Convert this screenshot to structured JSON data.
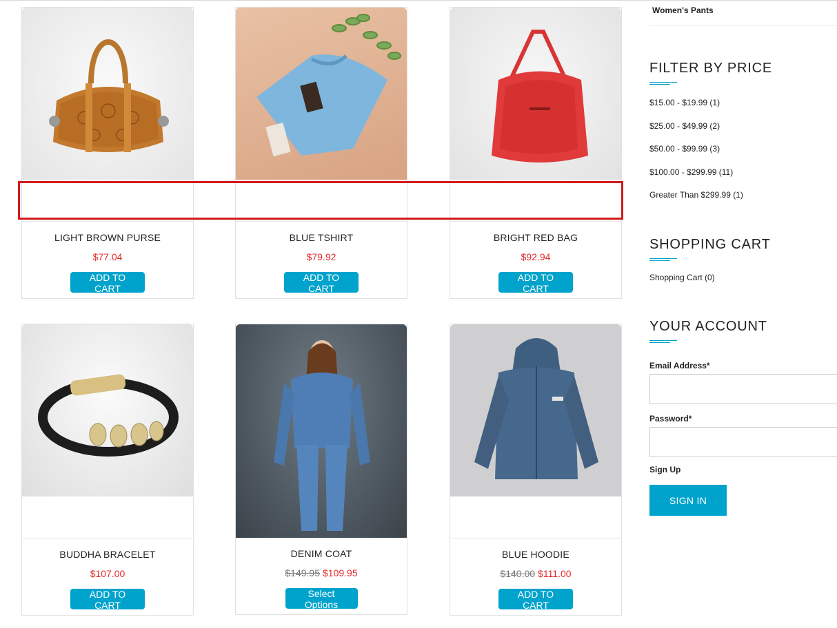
{
  "products": [
    {
      "name": "LIGHT BROWN PURSE",
      "price": "$77.04",
      "button": "ADD TO CART",
      "image": "brown-purse-image"
    },
    {
      "name": "BLUE TSHIRT",
      "price": "$79.92",
      "button": "ADD TO CART",
      "image": "blue-tshirt-image"
    },
    {
      "name": "BRIGHT RED BAG",
      "price": "$92.94",
      "button": "ADD TO CART",
      "image": "red-bag-image"
    },
    {
      "name": "BUDDHA BRACELET",
      "price": "$107.00",
      "button": "ADD TO CART",
      "image": "bracelet-image"
    },
    {
      "name": "DENIM COAT",
      "old_price": "$149.95",
      "price": "$109.95",
      "button": "Select Options",
      "image": "denim-coat-image"
    },
    {
      "name": "BLUE HOODIE",
      "old_price": "$140.00",
      "price": "$111.00",
      "button": "ADD TO CART",
      "image": "hoodie-image"
    }
  ],
  "sidebar": {
    "top_item": "Women's Pants",
    "filter_heading": "FILTER BY PRICE",
    "price_filters": [
      "$15.00 - $19.99 (1)",
      "$25.00 - $49.99 (2)",
      "$50.00 - $99.99 (3)",
      "$100.00 - $299.99 (11)",
      "Greater Than $299.99 (1)"
    ],
    "cart_heading": "SHOPPING CART",
    "cart_link": "Shopping Cart (0)",
    "account_heading": "YOUR ACCOUNT",
    "email_label": "Email Address*",
    "password_label": "Password*",
    "signup_link": "Sign Up",
    "signin_button": "SIGN IN"
  },
  "colors": {
    "accent": "#00a3cc",
    "price": "#e32b2b",
    "highlight": "#d11a1a"
  }
}
